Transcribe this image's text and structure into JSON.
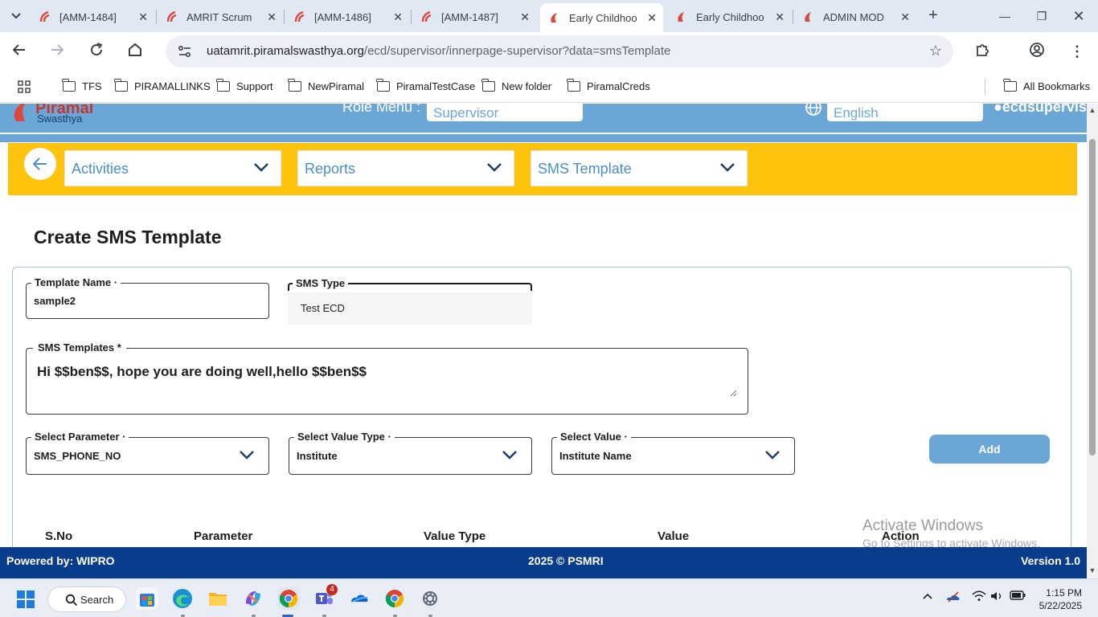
{
  "browser": {
    "tabs": [
      {
        "label": "[AMM-1484]",
        "icon": "jira-icon",
        "active": false
      },
      {
        "label": "AMRIT Scrum",
        "icon": "jira-icon",
        "active": false
      },
      {
        "label": "[AMM-1486]",
        "icon": "jira-icon",
        "active": false
      },
      {
        "label": "[AMM-1487]",
        "icon": "jira-icon",
        "active": false
      },
      {
        "label": "Early Childhoo",
        "icon": "piramal-icon",
        "active": true
      },
      {
        "label": "Early Childhoo",
        "icon": "piramal-icon",
        "active": false
      },
      {
        "label": "ADMIN MOD",
        "icon": "piramal-icon",
        "active": false
      }
    ],
    "url_host": "uatamrit.piramalswasthya.org",
    "url_path": "/ecd/supervisor/innerpage-supervisor?data=smsTemplate",
    "bookmarks": [
      "TFS",
      "PIRAMALLINKS",
      "Support",
      "NewPiramal",
      "PiramalTestCase",
      "New folder",
      "PiramalCreds"
    ],
    "all_bookmarks": "All Bookmarks"
  },
  "header": {
    "logo_title": "Piramal",
    "logo_subtitle": "Swasthya",
    "role_label": "Role Menu :",
    "role_value": "Supervisor",
    "language_value": "English",
    "user": "ecdsupervis"
  },
  "nav": {
    "activities": "Activities",
    "reports": "Reports",
    "sms_template": "SMS Template"
  },
  "page": {
    "title": "Create SMS Template"
  },
  "form": {
    "template_name_label": "Template Name",
    "template_name_value": "sample2",
    "sms_type_label": "SMS Type",
    "sms_type_value": "Test ECD",
    "sms_templates_label": "SMS Templates *",
    "sms_templates_value": "Hi $$ben$$, hope you are doing well,hello $$ben$$",
    "select_parameter_label": "Select Parameter",
    "select_parameter_value": "SMS_PHONE_NO",
    "select_value_type_label": "Select Value Type",
    "select_value_type_value": "Institute",
    "select_value_label": "Select Value",
    "select_value_value": "Institute Name",
    "add_button": "Add",
    "required_mark": "·"
  },
  "table": {
    "columns": [
      "S.No",
      "Parameter",
      "Value Type",
      "Value",
      "Action"
    ]
  },
  "watermark": {
    "line1": "Activate Windows",
    "line2": "Go to Settings to activate Windows."
  },
  "footer": {
    "powered": "Powered by: WIPRO",
    "copyright": "2025 © PSMRI",
    "version": "Version 1.0"
  },
  "taskbar": {
    "search_label": "Search",
    "teams_badge": "4",
    "time": "1:15 PM",
    "date": "5/22/2025"
  },
  "colors": {
    "header_blue": "#6aa7d6",
    "nav_yellow": "#fec30d",
    "footer_navy": "#0a3c8c",
    "link_blue": "#4a8fc7"
  }
}
